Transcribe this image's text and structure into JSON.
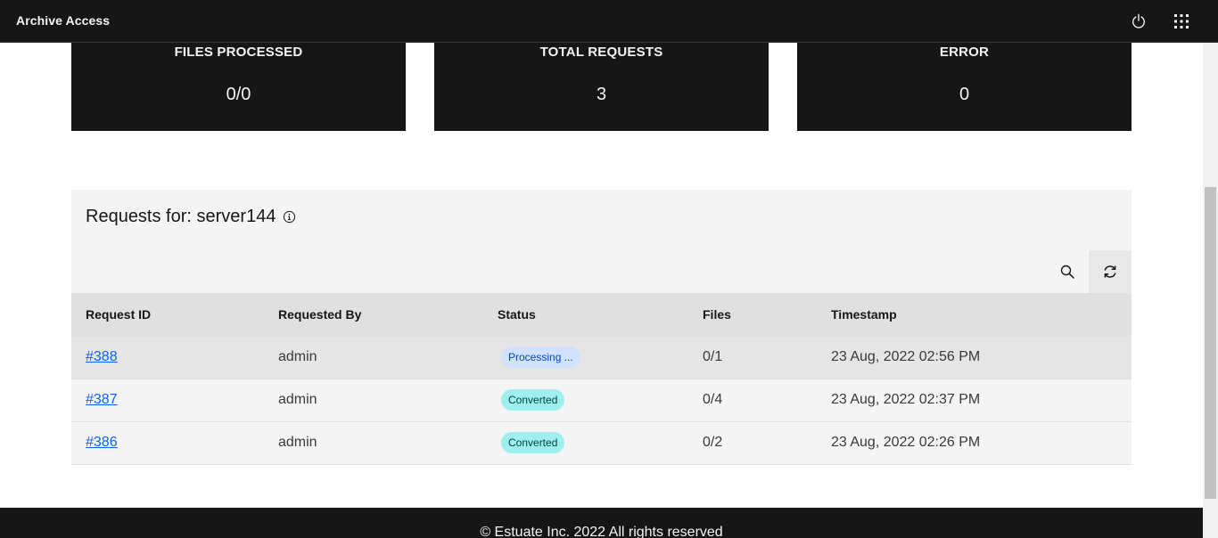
{
  "app": {
    "title": "Archive Access"
  },
  "header": {
    "power_icon": "power-icon",
    "apps_icon": "app-switcher-icon"
  },
  "stats": [
    {
      "label": "FILES PROCESSED",
      "value": "0/0"
    },
    {
      "label": "TOTAL REQUESTS",
      "value": "3"
    },
    {
      "label": "ERROR",
      "value": "0"
    }
  ],
  "requests": {
    "title": "Requests for: server144",
    "info_icon": "information-icon",
    "toolbar": {
      "search_icon": "search-icon",
      "refresh_icon": "refresh-icon"
    },
    "columns": [
      "Request ID",
      "Requested By",
      "Status",
      "Files",
      "Timestamp"
    ],
    "rows": [
      {
        "id": "#388",
        "by": "admin",
        "status": "Processing ...",
        "status_kind": "processing",
        "files": "0/1",
        "timestamp": "23 Aug, 2022 02:56 PM"
      },
      {
        "id": "#387",
        "by": "admin",
        "status": "Converted",
        "status_kind": "converted",
        "files": "0/4",
        "timestamp": "23 Aug, 2022 02:37 PM"
      },
      {
        "id": "#386",
        "by": "admin",
        "status": "Converted",
        "status_kind": "converted",
        "files": "0/2",
        "timestamp": "23 Aug, 2022 02:26 PM"
      }
    ]
  },
  "footer": {
    "text": "© Estuate Inc. 2022  All rights reserved"
  },
  "colors": {
    "header_bg": "#161616",
    "panel_bg": "#f4f4f4",
    "link": "#0f62fe",
    "processing_tag": "#d0e2ff",
    "converted_tag": "#9ef0f0"
  }
}
